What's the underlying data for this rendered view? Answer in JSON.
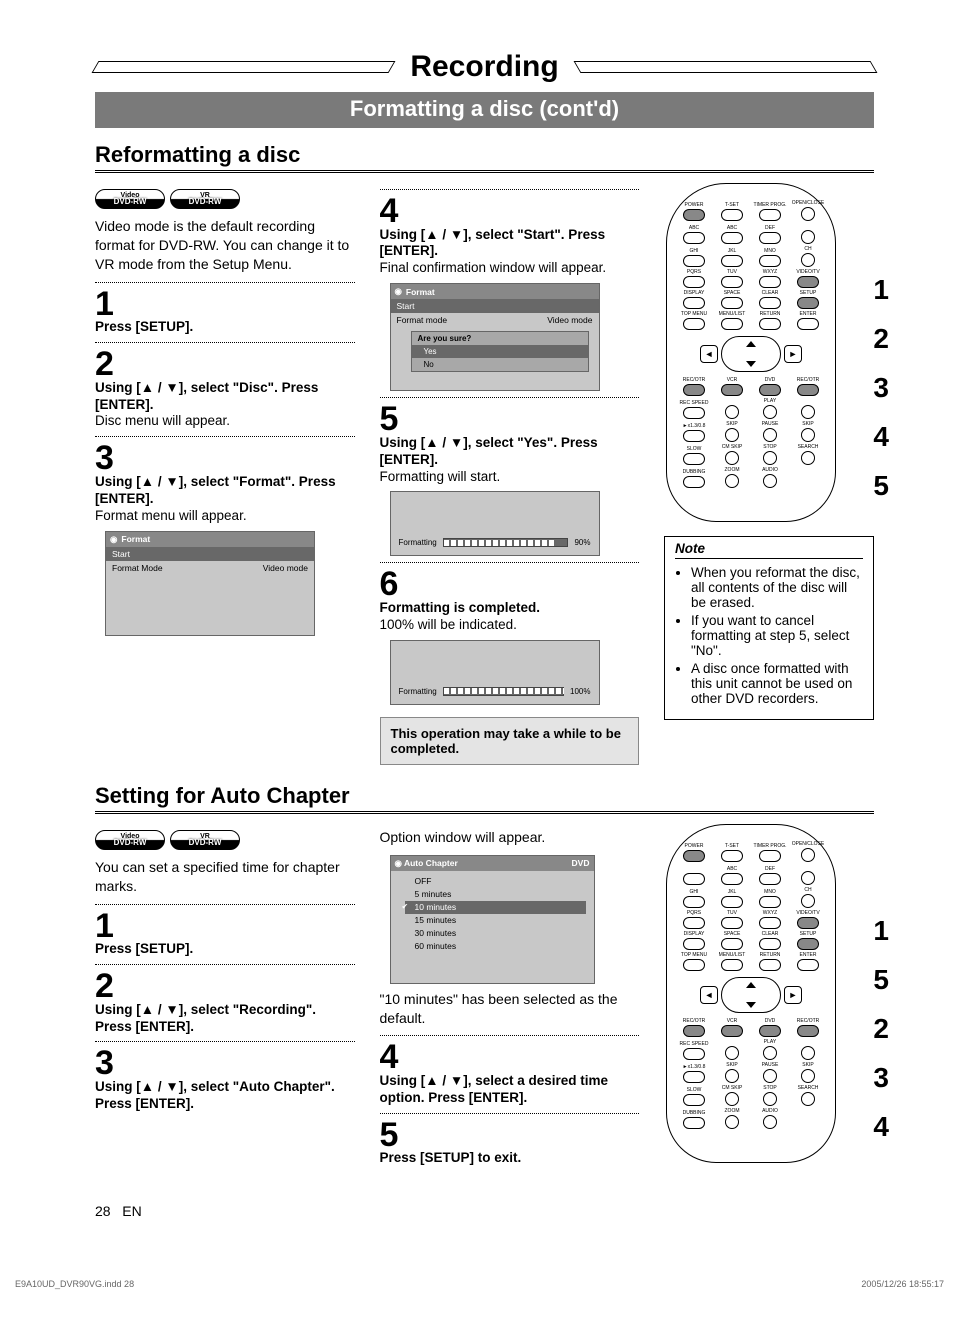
{
  "page": {
    "number": "28",
    "lang": "EN",
    "footer_file": "E9A10UD_DVR90VG.indd   28",
    "footer_time": "2005/12/26   18:55:17"
  },
  "title": "Recording",
  "subtitle": "Formatting a disc (cont'd)",
  "section1": {
    "heading": "Reformatting a disc",
    "badge1_top": "Video",
    "badge1_bot": "DVD-RW",
    "badge2_top": "VR",
    "badge2_bot": "DVD-RW",
    "intro": "Video mode is the default recording format for DVD-RW. You can change it to VR mode from the Setup Menu.",
    "step1_bold": "Press [SETUP].",
    "step2_bold": "Using [▲ / ▼], select \"Disc\". Press [ENTER].",
    "step2_plain": "Disc menu will appear.",
    "step3_bold": "Using [▲ / ▼], select \"Format\". Press [ENTER].",
    "step3_plain": "Format menu will appear.",
    "menu3": {
      "title": "Format",
      "row1": "Start",
      "row2a": "Format Mode",
      "row2b": "Video mode"
    },
    "step4_bold": "Using [▲ / ▼], select \"Start\". Press [ENTER].",
    "step4_plain": "Final confirmation window will appear.",
    "menu4": {
      "title": "Format",
      "row1": "Start",
      "row2a": "Format mode",
      "row2b": "Video mode",
      "q": "Are you sure?",
      "opt1": "Yes",
      "opt2": "No"
    },
    "step5_bold": "Using [▲ / ▼], select \"Yes\". Press [ENTER].",
    "step5_plain": "Formatting will start.",
    "prog5": {
      "label": "Formatting",
      "pct": "90%"
    },
    "step6_bold": "Formatting is completed.",
    "step6_plain": "100% will be indicated.",
    "prog6": {
      "label": "Formatting",
      "pct": "100%"
    },
    "opnote": "This operation may take a while to be completed.",
    "note_title": "Note",
    "note1": "When you reformat the disc, all contents of the disc will be erased.",
    "note2": "If you want to cancel formatting at step 5, select \"No\".",
    "note3": "A disc once formatted with this unit cannot be used on other DVD recorders.",
    "sidenums": [
      "1",
      "2",
      "3",
      "4",
      "5"
    ]
  },
  "section2": {
    "heading": "Setting for Auto Chapter",
    "badge1_top": "Video",
    "badge1_bot": "DVD-RW",
    "badge2_top": "VR",
    "badge2_bot": "DVD-RW",
    "intro": "You can set a specified time for chapter marks.",
    "step1_bold": "Press [SETUP].",
    "step2_bold": "Using [▲ / ▼], select \"Recording\". Press [ENTER].",
    "step3_bold": "Using [▲ / ▼], select \"Auto Chapter\". Press [ENTER].",
    "col2_intro": "Option window will appear.",
    "menu": {
      "title": "Auto Chapter",
      "tag": "DVD",
      "items": [
        "OFF",
        "5 minutes",
        "10 minutes",
        "15 minutes",
        "30 minutes",
        "60 minutes"
      ],
      "selected": "10 minutes"
    },
    "default_note": "\"10 minutes\" has been selected as the default.",
    "step4_bold": "Using [▲ / ▼], select a desired time option. Press [ENTER].",
    "step5_bold": "Press [SETUP] to exit.",
    "sidenums": [
      "1",
      "5",
      "2",
      "3",
      "4"
    ]
  },
  "remote_labels": {
    "power": "POWER",
    "tset": "T-SET",
    "timer": "TIMER PROG.",
    "open": "OPEN/CLOSE",
    "abc": "ABC",
    "def": "DEF",
    "ghi": "GHI",
    "jkl": "JKL",
    "mno": "MNO",
    "ch": "CH",
    "pqrs": "PQRS",
    "tuv": "TUV",
    "wxyz": "WXYZ",
    "video": "VIDEO/TV",
    "display": "DISPLAY",
    "space": "SPACE",
    "clear": "CLEAR",
    "setup": "SETUP",
    "topmenu": "TOP MENU",
    "menulist": "MENU/LIST",
    "return": "RETURN",
    "enter": "ENTER",
    "rec": "REC/OTR",
    "vcr": "VCR",
    "dvd": "DVD",
    "recotr": "REC/OTR",
    "recspeed": "REC SPEED",
    "play": "PLAY",
    "skip": "SKIP",
    "pause": "PAUSE",
    "slow": "SLOW",
    "cmskip": "CM SKIP",
    "stop": "STOP",
    "search": "SEARCH",
    "dubbing": "DUBBING",
    "zoom": "ZOOM",
    "audio": "AUDIO",
    "x130": "►x1.3/0.8"
  }
}
